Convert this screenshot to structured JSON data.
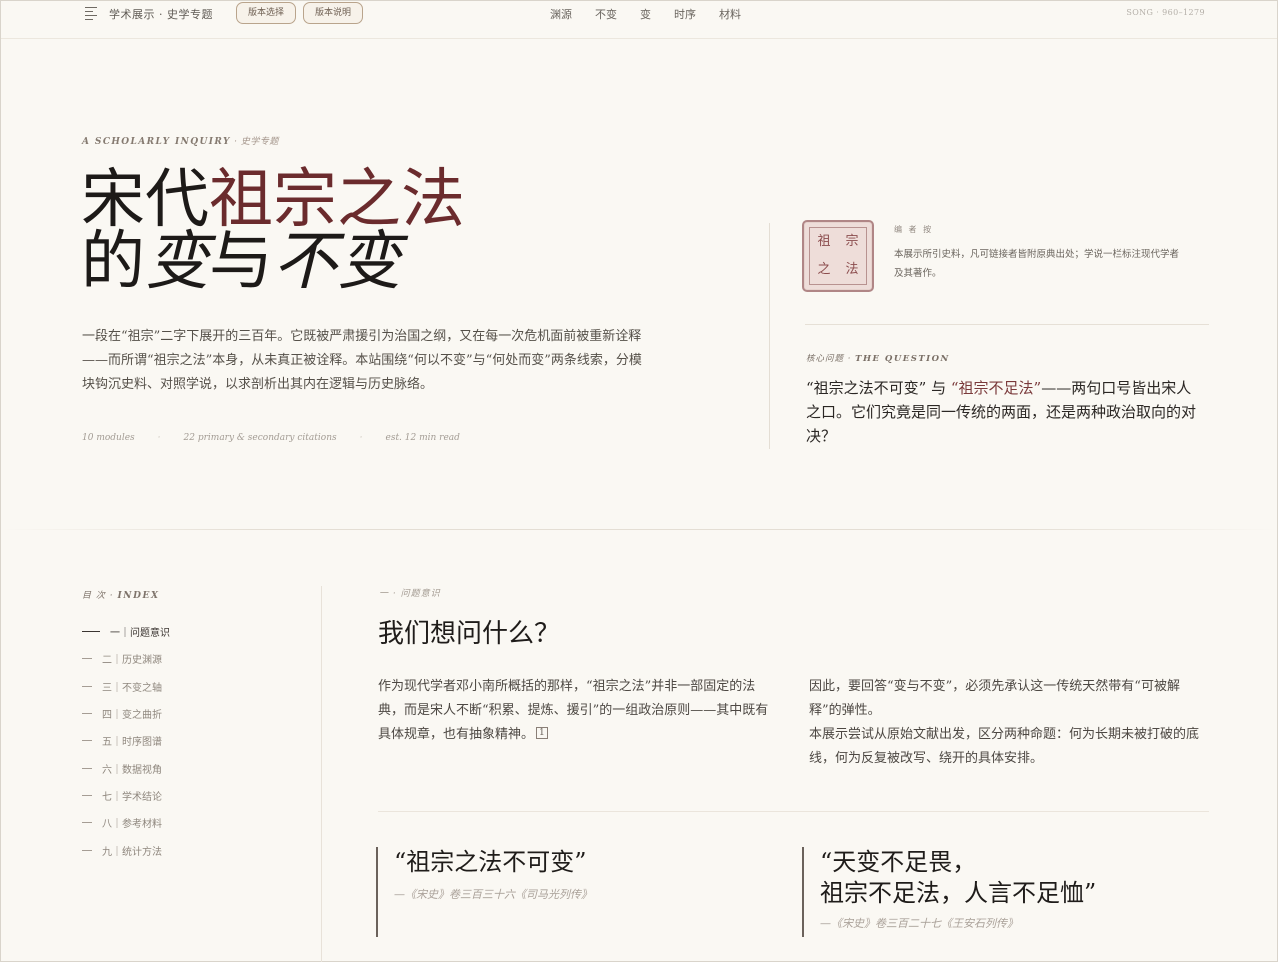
{
  "topbar": {
    "brand": "学术展示 · 史学专题",
    "pill_1": "版本选择",
    "pill_2": "版本说明",
    "nav": [
      "渊源",
      "不变",
      "变",
      "时序",
      "材料"
    ],
    "period": "SONG · 960–1279"
  },
  "hero": {
    "eyebrow_en": "A SCHOLARLY INQUIRY",
    "eyebrow_sep": " · ",
    "eyebrow_cn": "史学专题",
    "title_line1_a": "宋代",
    "title_line1_b": "祖宗之法",
    "title_line2_a": "的",
    "title_line2_b": "变",
    "title_line2_c": "与",
    "title_line2_d": "不变",
    "lead": "一段在“祖宗”二字下展开的三百年。它既被严肃援引为治国之纲，又在每一次危机面前被重新诠释——而所谓“祖宗之法”本身，从未真正被诠释。本站围绕“何以不变”与“何处而变”两条线索，分模块钩沉史料、对照学说，以求剖析出其内在逻辑与历史脉络。",
    "meta": [
      "10 modules",
      "22 primary & secondary citations",
      "est. 12 min read"
    ]
  },
  "seal": {
    "chars": [
      "祖",
      "宗",
      "之",
      "法"
    ]
  },
  "editor_note": {
    "heading": "编 者 按",
    "body": "本展示所引史料，凡可链接者皆附原典出处；学说一栏标注现代学者及其著作。"
  },
  "question": {
    "heading_cn": "核心问题",
    "heading_sep": " · ",
    "heading_en": "THE QUESTION",
    "q1": "“祖宗之法不可变”",
    "mid": " 与 ",
    "q2": "“祖宗不足法”",
    "rest": "——两句口号皆出宋人之口。它们究竟是同一传统的两面，还是两种政治取向的对决？"
  },
  "index": {
    "heading_cn": "目 次",
    "heading_sep": " · ",
    "heading_en": "INDEX",
    "items": [
      "一｜问题意识",
      "二｜历史渊源",
      "三｜不变之轴",
      "四｜变之曲折",
      "五｜时序图谱",
      "六｜数据视角",
      "七｜学术结论",
      "八｜参考材料",
      "九｜统计方法"
    ]
  },
  "section": {
    "eyebrow": "一 · 问题意识",
    "title": "我们想问什么？",
    "col1": "作为现代学者邓小南所概括的那样，“祖宗之法”并非一部固定的法典，而是宋人不断“积累、提炼、援引”的一组政治原则——其中既有具体规章，也有抽象精神。",
    "col1_fn": "1",
    "col2_p1": "因此，要回答“变与不变”，必须先承认这一传统天然带有“可被解释”的弹性。",
    "col2_p2": "本展示尝试从原始文献出发，区分两种命题：何为长期未被打破的底线，何为反复被改写、绕开的具体安排。"
  },
  "quotes": [
    {
      "text": "“祖宗之法不可变”",
      "source": "—《宋史》卷三百三十六《司马光列传》"
    },
    {
      "line1": "“天变不足畏，",
      "line2": "祖宗不足法，人言不足恤”",
      "source": "—《宋史》卷三百二十七《王安石列传》"
    }
  ]
}
